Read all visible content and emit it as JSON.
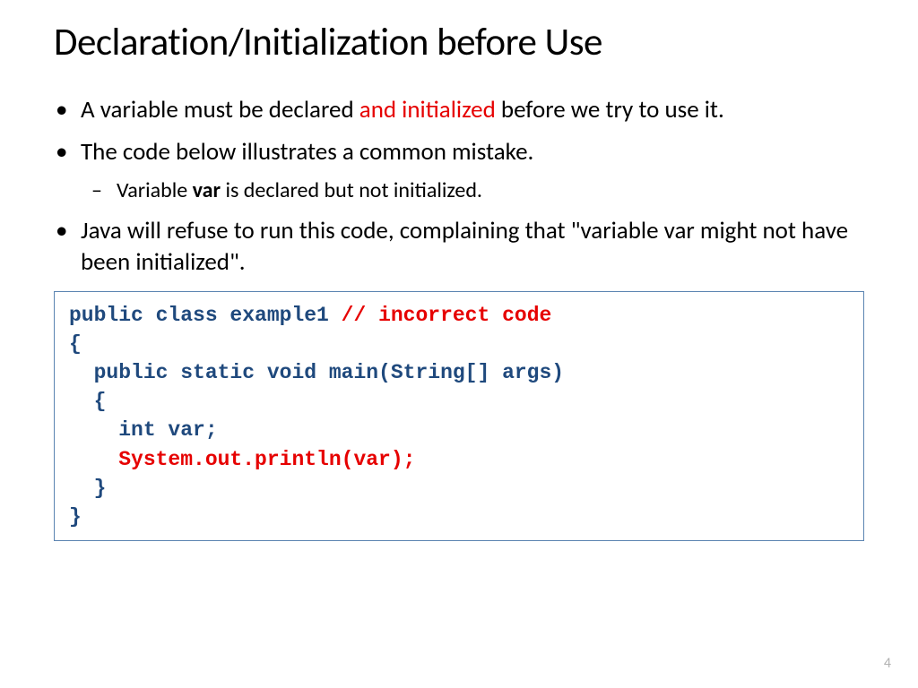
{
  "title": "Declaration/Initialization before Use",
  "bullets": {
    "b1_pre": "A variable must be declared ",
    "b1_red": "and initialized",
    "b1_post": " before we try to use it.",
    "b2": "The code below illustrates a common mistake.",
    "b2_sub_pre": "Variable ",
    "b2_sub_bold": "var",
    "b2_sub_post": " is declared but not initialized.",
    "b3": "Java will refuse to run this code, complaining that \"variable var might not have been initialized\"."
  },
  "code": {
    "l1a": "public class example1 ",
    "l1b": "// incorrect code",
    "l2": "{",
    "l3": "  public static void main(String[] args)",
    "l4": "  {",
    "l5": "    int var;",
    "l6": "    System.out.println(var);",
    "l7": "  }",
    "l8": "}"
  },
  "page_number": "4"
}
